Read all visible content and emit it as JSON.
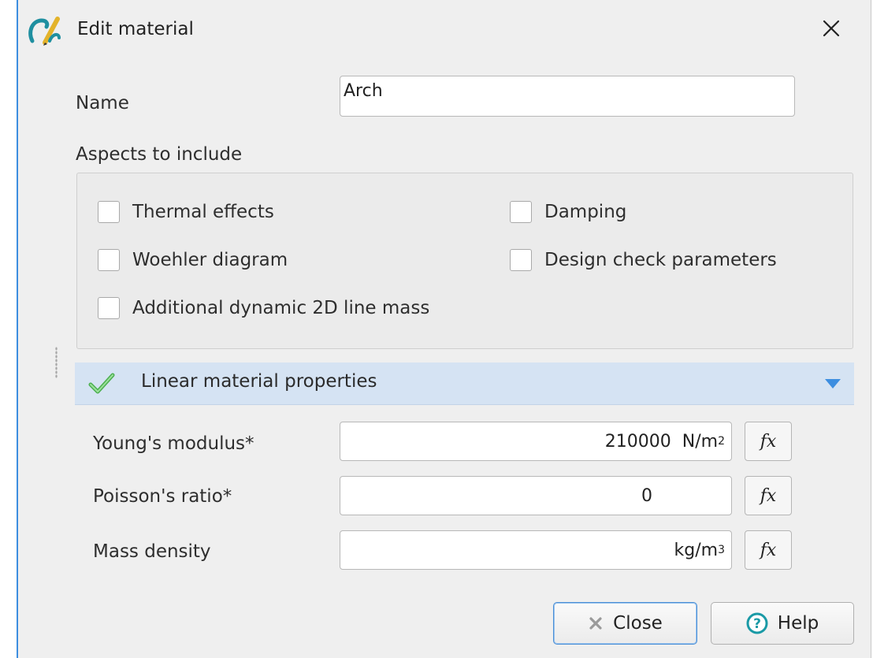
{
  "window": {
    "title": "Edit material",
    "close_icon": "close-icon"
  },
  "name": {
    "label": "Name",
    "value": "Arch"
  },
  "aspects": {
    "label": "Aspects to include",
    "items": [
      {
        "label": "Thermal effects",
        "checked": false
      },
      {
        "label": "Damping",
        "checked": false
      },
      {
        "label": "Woehler diagram",
        "checked": false
      },
      {
        "label": "Design check parameters",
        "checked": false
      },
      {
        "label": "Additional dynamic 2D line mass",
        "checked": false
      }
    ]
  },
  "section": {
    "title": "Linear material properties",
    "status_icon": "green-check-icon",
    "toggle_icon": "caret-down-icon"
  },
  "properties": [
    {
      "label": "Young's modulus*",
      "value": "210000",
      "unit": "N/m",
      "unit_exp": "2",
      "fx": "fx"
    },
    {
      "label": "Poisson's ratio*",
      "value": "0",
      "unit": "",
      "unit_exp": "",
      "fx": "fx"
    },
    {
      "label": "Mass density",
      "value": "",
      "unit": "kg/m",
      "unit_exp": "3",
      "fx": "fx"
    }
  ],
  "buttons": {
    "close": "Close",
    "help": "Help"
  },
  "colors": {
    "accent": "#3d8ee0",
    "section_bg": "#d5e3f3",
    "check_green": "#5cb85c",
    "help_teal": "#1a9aa6"
  }
}
